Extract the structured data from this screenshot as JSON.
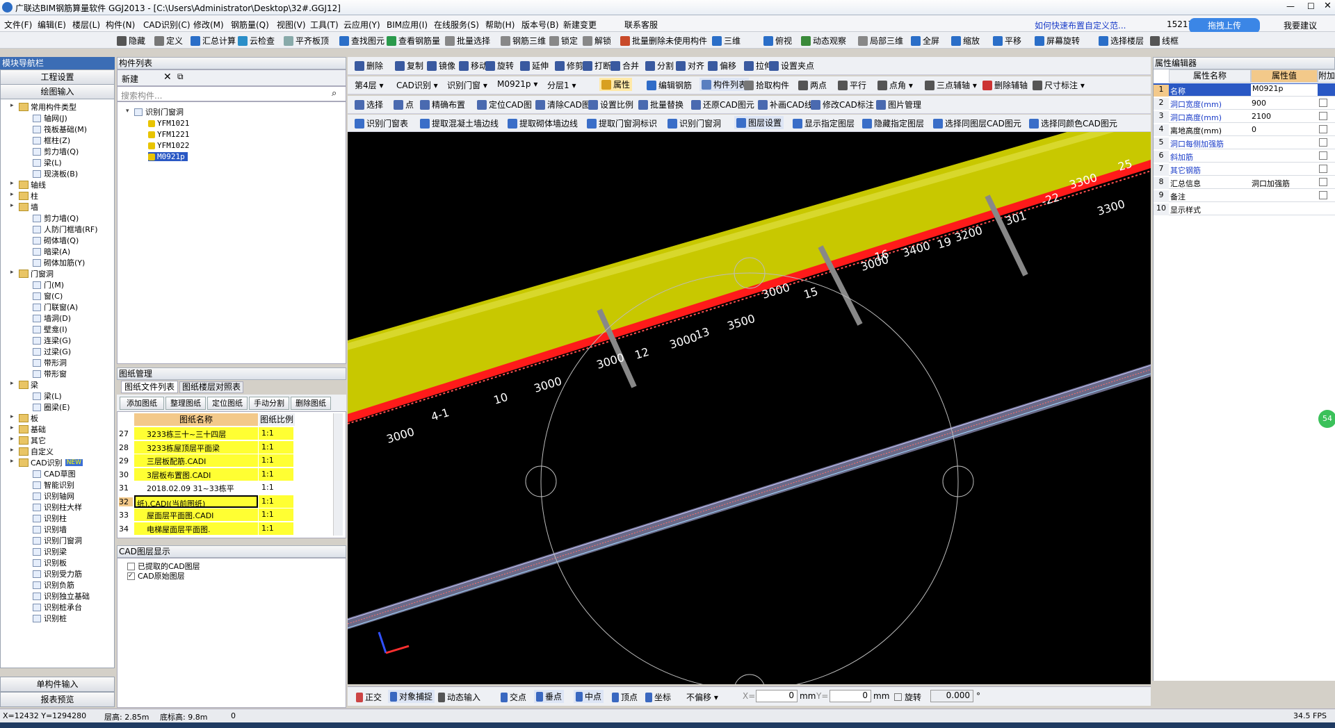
{
  "app": {
    "title": "广联达BIM钢筋算量软件 GGJ2013 - [C:\\Users\\Administrator\\Desktop\\32#.GGJ12]",
    "hint": "如何快速布置自定义范...",
    "user": "15217",
    "upload": "拖拽上传",
    "help_link": "我要建议"
  },
  "menu": [
    "文件(F)",
    "编辑(E)",
    "楼层(L)",
    "构件(N)",
    "CAD识别(C)",
    "修改(M)",
    "钢筋量(Q)",
    "视图(V)",
    "工具(T)",
    "云应用(Y)",
    "BIM应用(I)",
    "在线服务(S)",
    "帮助(H)",
    "版本号(B)",
    "新建变更",
    "联系客服"
  ],
  "toolbar1": [
    "隐藏",
    "定义",
    "汇总计算",
    "云检查",
    "平齐板顶",
    "查找图元",
    "查看钢筋量",
    "批量选择",
    "钢筋三维",
    "锁定",
    "解锁",
    "批量删除未使用构件",
    "三维",
    "俯视",
    "动态观察",
    "局部三维",
    "全屏",
    "缩放",
    "平移",
    "屏幕旋转",
    "选择楼层",
    "线框"
  ],
  "nav": {
    "title": "模块导航栏",
    "btn1": "工程设置",
    "btn2": "绘图输入",
    "btn3": "单构件输入",
    "btn4": "报表预览",
    "tree": [
      {
        "l": "常用构件类型",
        "d": 0,
        "f": 1
      },
      {
        "l": "轴网(J)",
        "d": 2
      },
      {
        "l": "筏板基础(M)",
        "d": 2
      },
      {
        "l": "框柱(Z)",
        "d": 2
      },
      {
        "l": "剪力墙(Q)",
        "d": 2
      },
      {
        "l": "梁(L)",
        "d": 2
      },
      {
        "l": "现浇板(B)",
        "d": 2
      },
      {
        "l": "轴线",
        "d": 0,
        "f": 1
      },
      {
        "l": "柱",
        "d": 0,
        "f": 1
      },
      {
        "l": "墙",
        "d": 0,
        "f": 1
      },
      {
        "l": "剪力墙(Q)",
        "d": 2
      },
      {
        "l": "人防门框墙(RF)",
        "d": 2
      },
      {
        "l": "砌体墙(Q)",
        "d": 2
      },
      {
        "l": "暗梁(A)",
        "d": 2
      },
      {
        "l": "砌体加筋(Y)",
        "d": 2
      },
      {
        "l": "门窗洞",
        "d": 0,
        "f": 1
      },
      {
        "l": "门(M)",
        "d": 2
      },
      {
        "l": "窗(C)",
        "d": 2
      },
      {
        "l": "门联窗(A)",
        "d": 2
      },
      {
        "l": "墙洞(D)",
        "d": 2
      },
      {
        "l": "壁龛(I)",
        "d": 2
      },
      {
        "l": "连梁(G)",
        "d": 2
      },
      {
        "l": "过梁(G)",
        "d": 2
      },
      {
        "l": "带形洞",
        "d": 2
      },
      {
        "l": "带形窗",
        "d": 2
      },
      {
        "l": "梁",
        "d": 0,
        "f": 1
      },
      {
        "l": "梁(L)",
        "d": 2
      },
      {
        "l": "圈梁(E)",
        "d": 2
      },
      {
        "l": "板",
        "d": 0,
        "f": 1
      },
      {
        "l": "基础",
        "d": 0,
        "f": 1
      },
      {
        "l": "其它",
        "d": 0,
        "f": 1
      },
      {
        "l": "自定义",
        "d": 0,
        "f": 1
      },
      {
        "l": "CAD识别",
        "d": 0,
        "f": 1
      },
      {
        "l": "CAD草图",
        "d": 2
      },
      {
        "l": "智能识别",
        "d": 2
      },
      {
        "l": "识别轴网",
        "d": 2
      },
      {
        "l": "识别柱大样",
        "d": 2
      },
      {
        "l": "识别柱",
        "d": 2
      },
      {
        "l": "识别墙",
        "d": 2
      },
      {
        "l": "识别门窗洞",
        "d": 2
      },
      {
        "l": "识别梁",
        "d": 2
      },
      {
        "l": "识别板",
        "d": 2
      },
      {
        "l": "识别受力筋",
        "d": 2
      },
      {
        "l": "识别负筋",
        "d": 2
      },
      {
        "l": "识别独立基础",
        "d": 2
      },
      {
        "l": "识别桩承台",
        "d": 2
      },
      {
        "l": "识别桩",
        "d": 2
      }
    ],
    "new_badge": "NEW"
  },
  "complist": {
    "title": "构件列表",
    "new": "新建",
    "search": "搜索构件...",
    "root": "识别门窗洞",
    "items": [
      "YFM1021",
      "YFM1221",
      "YFM1022",
      "M0921p"
    ]
  },
  "drawing": {
    "title": "图纸管理",
    "tab1": "图纸文件列表",
    "tab2": "图纸楼层对照表",
    "btns": [
      "添加图纸",
      "整理图纸",
      "定位图纸",
      "手动分割",
      "删除图纸"
    ],
    "col1": "图纸名称",
    "col2": "图纸比例",
    "rows": [
      {
        "n": "27",
        "name": "3233栋三十~三十四层",
        "s": "1:1"
      },
      {
        "n": "28",
        "name": "3233栋屋顶层平面梁",
        "s": "1:1"
      },
      {
        "n": "29",
        "name": "三层板配筋.CADI",
        "s": "1:1"
      },
      {
        "n": "30",
        "name": "3层板布置图.CADI",
        "s": "1:1"
      },
      {
        "n": "31",
        "name": "2018.02.09 31~33栋平",
        "s": "1:1"
      },
      {
        "n": "32",
        "name": "纸).CADI(当前图纸)",
        "s": "1:1"
      },
      {
        "n": "33",
        "name": "屋面层平面图.CADI",
        "s": "1:1"
      },
      {
        "n": "34",
        "name": "电梯屋面层平面图.",
        "s": "1:1"
      }
    ]
  },
  "cadlayer": {
    "title": "CAD图层显示",
    "items": [
      "已提取的CAD图层",
      "CAD原始图层"
    ]
  },
  "edit": [
    "删除",
    "复制",
    "镜像",
    "移动",
    "旋转",
    "延伸",
    "修剪",
    "打断",
    "合并",
    "分割",
    "对齐",
    "偏移",
    "拉伸",
    "设置夹点"
  ],
  "sel": {
    "floor": "第4层",
    "cad": "CAD识别",
    "mode": "识别门窗",
    "comp": "M0921p",
    "layer": "分层1",
    "b1": "属性",
    "b2": "编辑钢筋",
    "b3": "构件列表",
    "b4": "拾取构件",
    "b5": "两点",
    "b6": "平行",
    "b7": "点角",
    "b8": "三点辅轴",
    "b9": "删除辅轴",
    "b10": "尺寸标注"
  },
  "tb4": [
    "选择",
    "点",
    "精确布置",
    "定位CAD图",
    "清除CAD图",
    "设置比例",
    "批量替换",
    "还原CAD图元",
    "补画CAD线",
    "修改CAD标注",
    "图片管理"
  ],
  "tb5": [
    "识别门窗表",
    "提取混凝土墙边线",
    "提取砌体墙边线",
    "提取门窗洞标识",
    "识别门窗洞",
    "图层设置",
    "显示指定图层",
    "隐藏指定图层",
    "选择同图层CAD图元",
    "选择同颜色CAD图元"
  ],
  "props": {
    "title": "属性编辑器",
    "h1": "属性名称",
    "h2": "属性值",
    "h3": "附加",
    "rows": [
      {
        "n": "1",
        "k": "名称",
        "v": "M0921p"
      },
      {
        "n": "2",
        "k": "洞口宽度(mm)",
        "v": "900"
      },
      {
        "n": "3",
        "k": "洞口高度(mm)",
        "v": "2100"
      },
      {
        "n": "4",
        "k": "离地高度(mm)",
        "v": "0"
      },
      {
        "n": "5",
        "k": "洞口每侧加强筋",
        "v": ""
      },
      {
        "n": "6",
        "k": "斜加筋",
        "v": ""
      },
      {
        "n": "7",
        "k": "其它钢筋",
        "v": ""
      },
      {
        "n": "8",
        "k": "汇总信息",
        "v": "洞口加强筋"
      },
      {
        "n": "9",
        "k": "备注",
        "v": ""
      },
      {
        "n": "10",
        "k": "显示样式",
        "v": ""
      }
    ]
  },
  "bottom": {
    "b1": "正交",
    "b2": "对象捕捉",
    "b3": "动态输入",
    "b4": "交点",
    "b5": "垂点",
    "b6": "中点",
    "b7": "顶点",
    "b8": "坐标",
    "b9": "不偏移",
    "xl": "X=",
    "xv": "0",
    "xu": "mm",
    "yl": "Y=",
    "yv": "0",
    "yu": "mm",
    "rot": "旋转",
    "rv": "0.000",
    "deg": "°"
  },
  "status": {
    "coord": "X=12432 Y=1294280",
    "fh": "层高: 2.85m",
    "bh": "底标高: 9.8m",
    "z": "0",
    "fps": "34.5 FPS"
  },
  "canvas_labels": [
    "25",
    "3300",
    "3300",
    "-22",
    "301",
    "3200",
    "19",
    "3400",
    "16",
    "3000",
    "15",
    "3000",
    "3500",
    "13",
    "3000",
    "12",
    "3000",
    "3000",
    "10",
    "4-1",
    "3000"
  ]
}
